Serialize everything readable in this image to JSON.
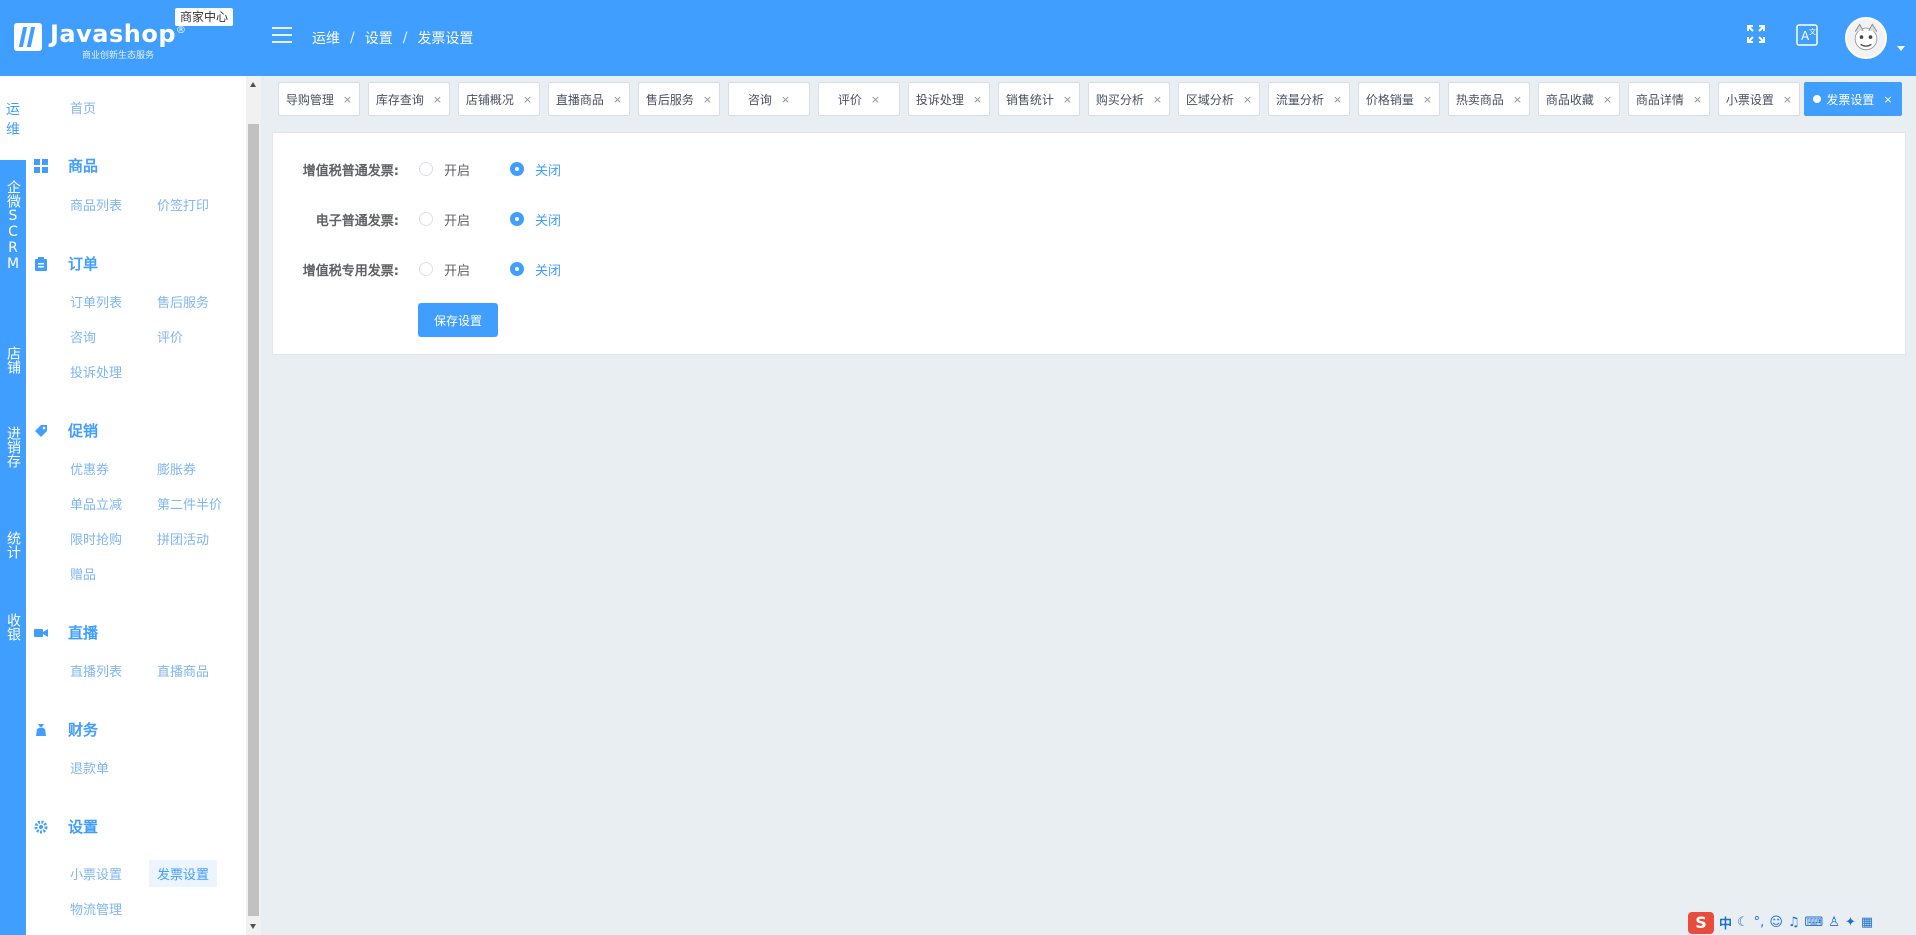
{
  "header": {
    "logo_text": "Javashop",
    "logo_reg": "®",
    "logo_sub": "商业创新生态服务",
    "merchant_badge": "商家中心",
    "breadcrumb": [
      "运维",
      "设置",
      "发票设置"
    ],
    "breadcrumb_sep": "/"
  },
  "rail": {
    "items": [
      "运维",
      "企微SCRM",
      "店铺",
      "进销存",
      "统计",
      "收银"
    ]
  },
  "sidebar": {
    "home": "首页",
    "groups": [
      {
        "title": "商品",
        "icon": "grid-icon",
        "items": [
          "商品列表",
          "价签打印"
        ]
      },
      {
        "title": "订单",
        "icon": "clipboard-icon",
        "items": [
          "订单列表",
          "售后服务",
          "咨询",
          "评价",
          "投诉处理"
        ]
      },
      {
        "title": "促销",
        "icon": "tag-icon",
        "items": [
          "优惠券",
          "膨胀券",
          "单品立减",
          "第二件半价",
          "限时抢购",
          "拼团活动",
          "赠品"
        ]
      },
      {
        "title": "直播",
        "icon": "video-camera-icon",
        "items": [
          "直播列表",
          "直播商品"
        ]
      },
      {
        "title": "财务",
        "icon": "money-bag-icon",
        "items": [
          "退款单"
        ]
      },
      {
        "title": "设置",
        "icon": "gear-icon",
        "items": [
          "小票设置",
          "发票设置",
          "物流管理"
        ]
      }
    ],
    "active_item": "发票设置"
  },
  "tabs": {
    "items": [
      "导购管理",
      "库存查询",
      "店铺概况",
      "直播商品",
      "售后服务",
      "咨询",
      "评价",
      "投诉处理",
      "销售统计",
      "购买分析",
      "区域分析",
      "流量分析",
      "价格销量",
      "热卖商品",
      "商品收藏",
      "商品详情",
      "小票设置",
      "发票设置"
    ],
    "active": "发票设置",
    "close_glyph": "×"
  },
  "form": {
    "rows": [
      {
        "label": "增值税普通发票:",
        "options": [
          "开启",
          "关闭"
        ],
        "selected": "关闭"
      },
      {
        "label": "电子普通发票:",
        "options": [
          "开启",
          "关闭"
        ],
        "selected": "关闭"
      },
      {
        "label": "增值税专用发票:",
        "options": [
          "开启",
          "关闭"
        ],
        "selected": "关闭"
      }
    ],
    "save_label": "保存设置"
  },
  "ime": {
    "logo": "S",
    "lang": "中"
  },
  "colors": {
    "primary": "#409eff",
    "background": "#e9eef3",
    "link": "#7fb6f2"
  }
}
